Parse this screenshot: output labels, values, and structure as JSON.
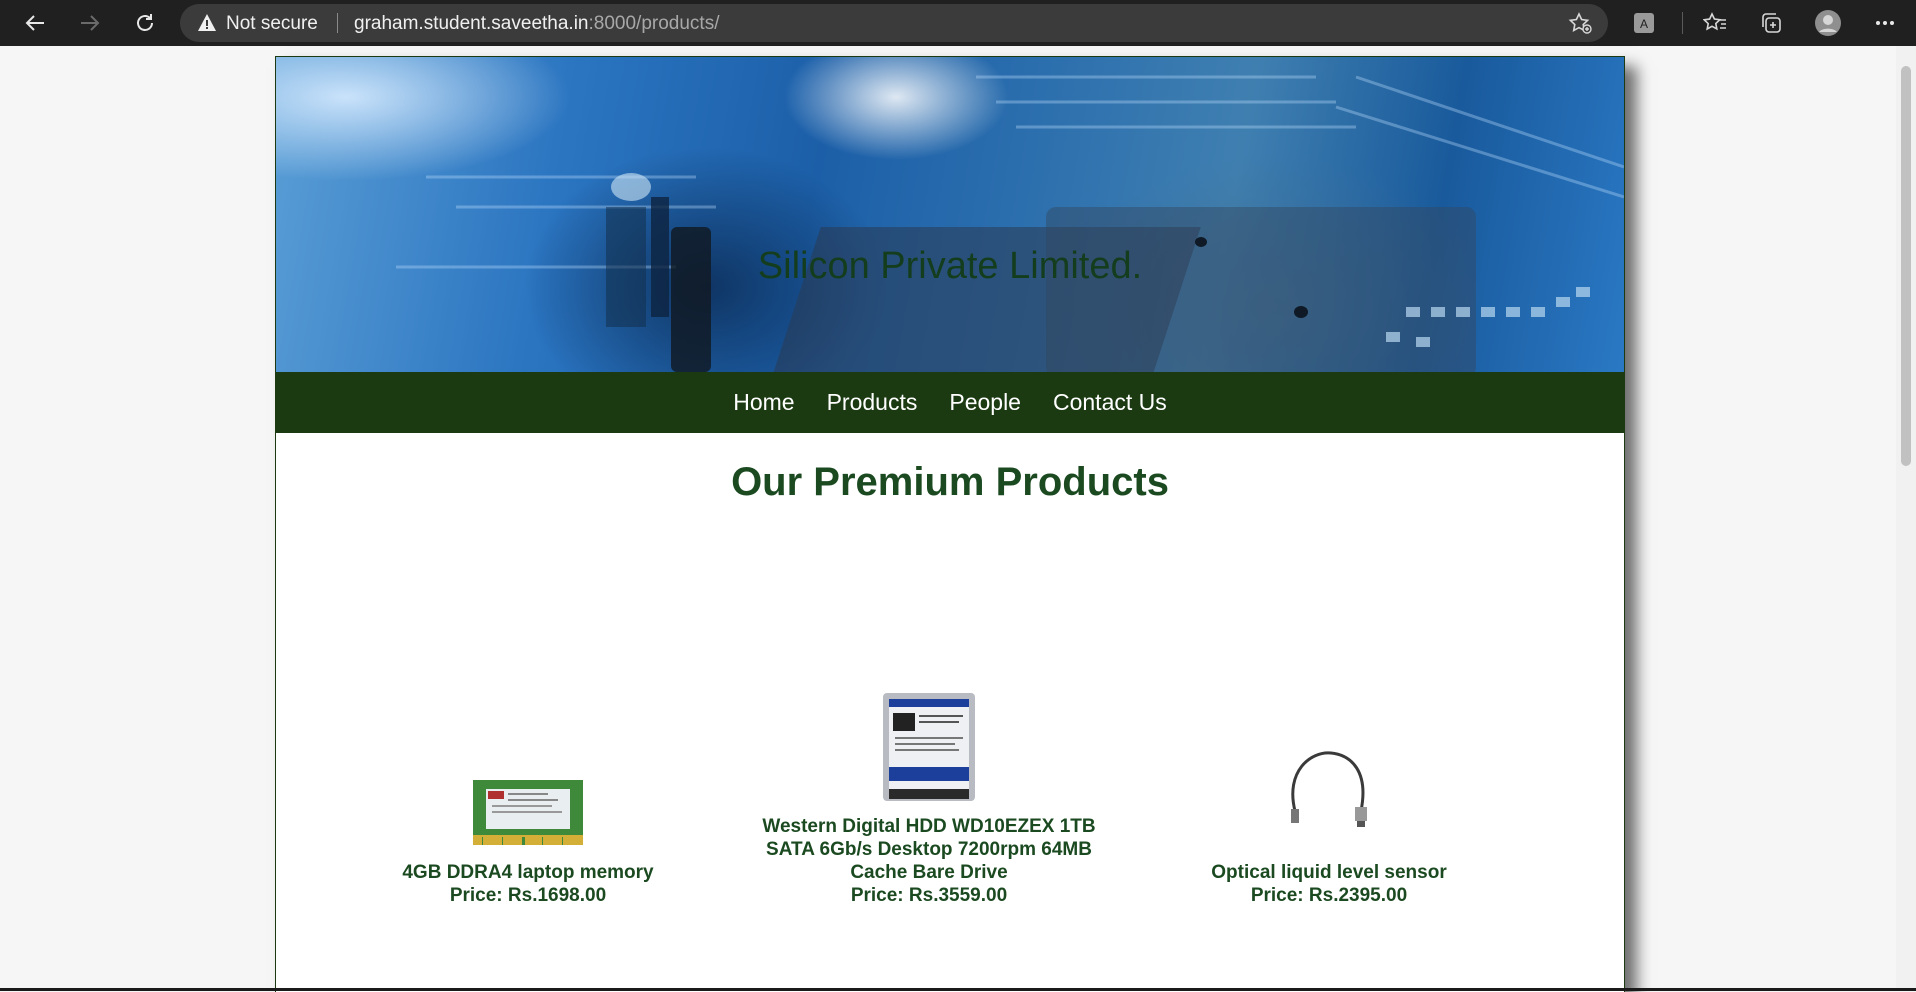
{
  "browser": {
    "security_label": "Not secure",
    "url_host": "graham.student.saveetha.in",
    "url_rest": ":8000/products/",
    "icons": [
      "back-arrow-icon",
      "forward-arrow-icon",
      "refresh-icon",
      "warning-icon",
      "add-favorite-icon",
      "extension-icon",
      "favorites-icon",
      "collections-icon",
      "profile-icon",
      "more-icon"
    ]
  },
  "site": {
    "title": "Silicon Private Limited.",
    "nav": [
      "Home",
      "Products",
      "People",
      "Contact Us"
    ],
    "heading": "Our Premium Products",
    "products": [
      {
        "name": "4GB DDRA4 laptop memory",
        "price": "Price: Rs.1698.00"
      },
      {
        "name": "Western Digital HDD WD10EZEX 1TB SATA 6Gb/s Desktop 7200rpm 64MB Cache Bare Drive",
        "price": "Price: Rs.3559.00"
      },
      {
        "name": "Optical liquid level sensor",
        "price": "Price: Rs.2395.00"
      }
    ]
  },
  "colors": {
    "brand_green": "#1b3a12",
    "heading_green": "#1b4a21",
    "chrome": "#202020"
  }
}
